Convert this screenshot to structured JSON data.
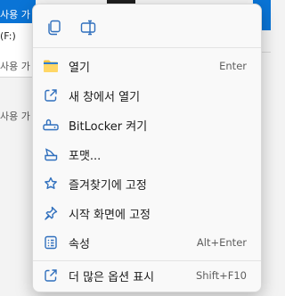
{
  "background": {
    "rows": [
      "사용 가",
      "(F:)",
      "사용 가",
      "사용 가"
    ],
    "accent_color": "#0a74d6"
  },
  "toolbar": {
    "buttons": [
      {
        "icon": "copy-icon"
      },
      {
        "icon": "rename-icon"
      }
    ]
  },
  "menu": {
    "items": [
      {
        "label": "열기",
        "accel": "Enter",
        "icon": "folder-icon"
      },
      {
        "label": "새 창에서 열기",
        "accel": "",
        "icon": "open-external-icon"
      },
      {
        "label": "BitLocker 켜기",
        "accel": "",
        "icon": "key-icon"
      },
      {
        "label": "포맷...",
        "accel": "",
        "icon": "format-icon"
      },
      {
        "label": "즐겨찾기에 고정",
        "accel": "",
        "icon": "star-icon"
      },
      {
        "label": "시작 화면에 고정",
        "accel": "",
        "icon": "pin-icon"
      },
      {
        "label": "속성",
        "accel": "Alt+Enter",
        "icon": "properties-icon"
      },
      {
        "label": "더 많은 옵션 표시",
        "accel": "Shift+F10",
        "icon": "more-options-icon"
      }
    ]
  }
}
